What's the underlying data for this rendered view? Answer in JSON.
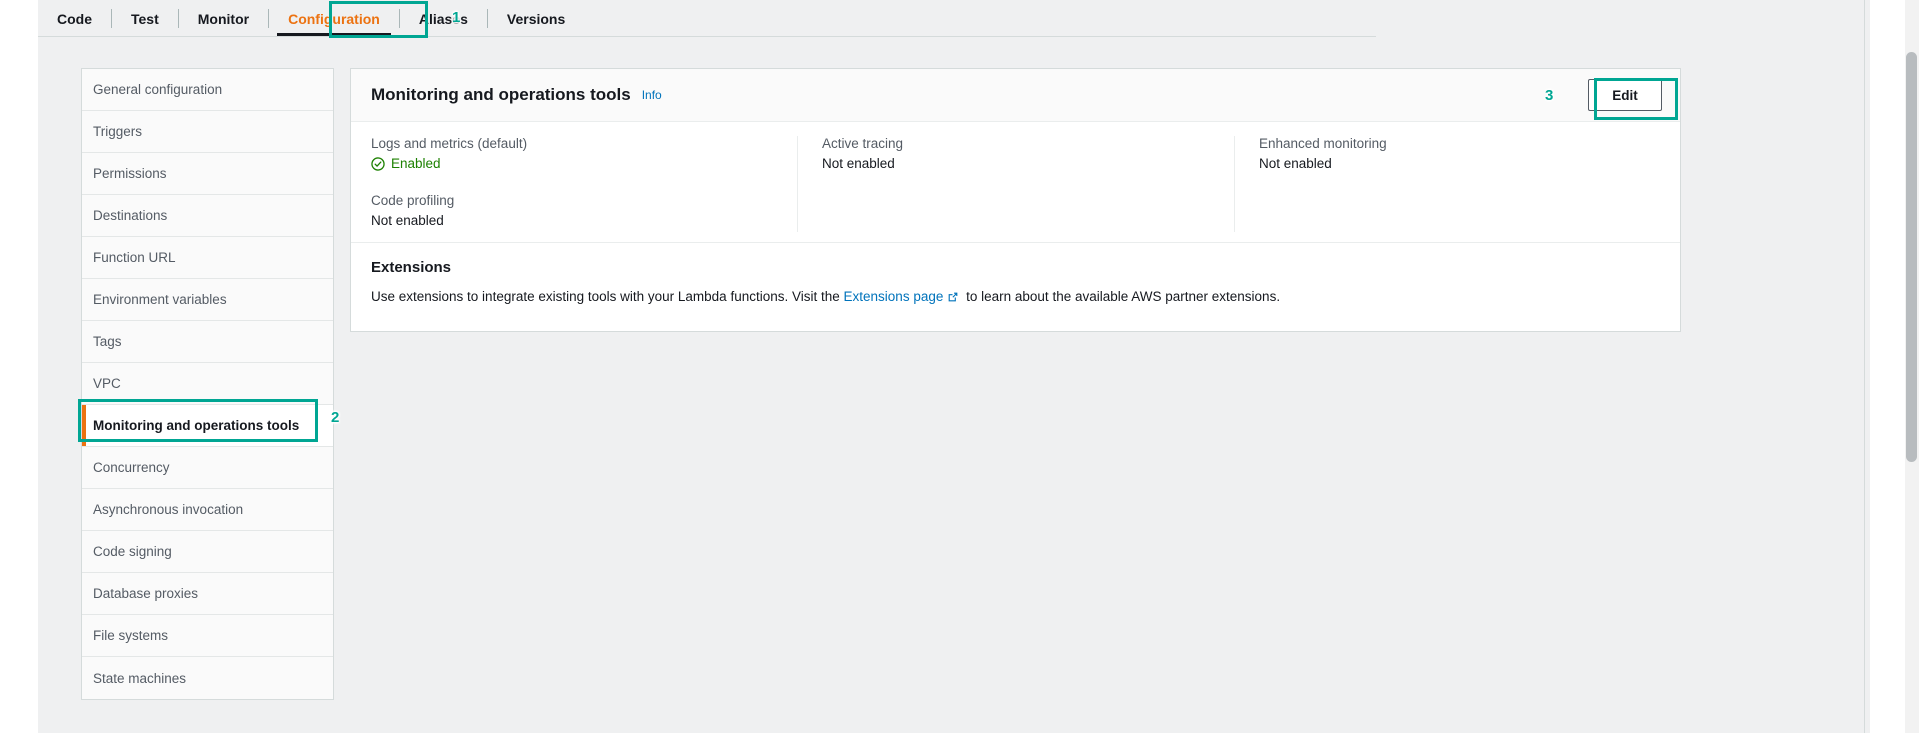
{
  "tabs": [
    {
      "label": "Code",
      "active": false
    },
    {
      "label": "Test",
      "active": false
    },
    {
      "label": "Monitor",
      "active": false
    },
    {
      "label": "Configuration",
      "active": true
    },
    {
      "label": "Aliases",
      "active": false
    },
    {
      "label": "Versions",
      "active": false
    }
  ],
  "annotations": {
    "marker_1": "1",
    "marker_2": "2",
    "marker_3": "3",
    "highlight_color": "#00a693"
  },
  "sidebar": {
    "items": [
      {
        "label": "General configuration",
        "selected": false
      },
      {
        "label": "Triggers",
        "selected": false
      },
      {
        "label": "Permissions",
        "selected": false
      },
      {
        "label": "Destinations",
        "selected": false
      },
      {
        "label": "Function URL",
        "selected": false
      },
      {
        "label": "Environment variables",
        "selected": false
      },
      {
        "label": "Tags",
        "selected": false
      },
      {
        "label": "VPC",
        "selected": false
      },
      {
        "label": "Monitoring and operations tools",
        "selected": true
      },
      {
        "label": "Concurrency",
        "selected": false
      },
      {
        "label": "Asynchronous invocation",
        "selected": false
      },
      {
        "label": "Code signing",
        "selected": false
      },
      {
        "label": "Database proxies",
        "selected": false
      },
      {
        "label": "File systems",
        "selected": false
      },
      {
        "label": "State machines",
        "selected": false
      }
    ]
  },
  "card": {
    "title": "Monitoring and operations tools",
    "info_label": "Info",
    "edit_label": "Edit",
    "fields": {
      "logs_metrics": {
        "label": "Logs and metrics (default)",
        "value": "Enabled"
      },
      "code_profiling": {
        "label": "Code profiling",
        "value": "Not enabled"
      },
      "active_tracing": {
        "label": "Active tracing",
        "value": "Not enabled"
      },
      "enhanced_monitoring": {
        "label": "Enhanced monitoring",
        "value": "Not enabled"
      }
    },
    "extensions": {
      "title": "Extensions",
      "desc_before": "Use extensions to integrate existing tools with your Lambda functions. Visit the",
      "link_label": "Extensions page",
      "desc_after": "to learn about the available AWS partner extensions."
    }
  }
}
